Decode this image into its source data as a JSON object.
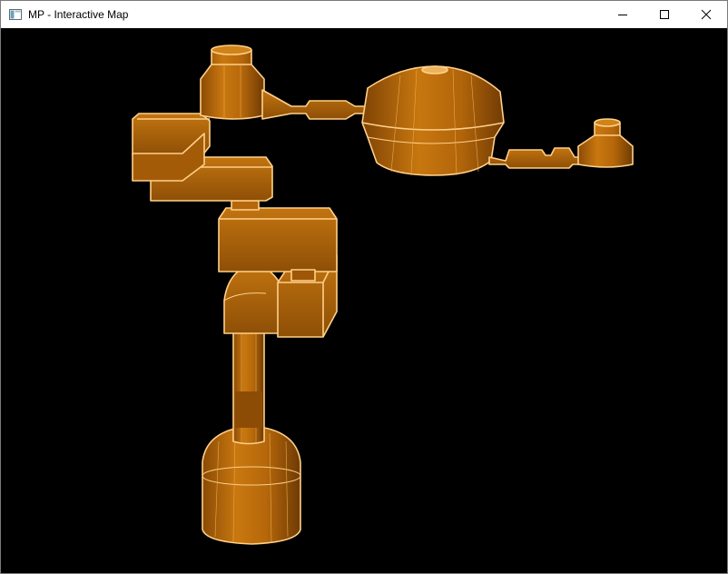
{
  "window": {
    "title": "MP - Interactive Map"
  },
  "icons": {
    "app": "app-window-icon",
    "minimize": "minimize-icon",
    "maximize": "maximize-icon",
    "close": "close-icon"
  },
  "colors": {
    "room_fill": "#b8690a",
    "room_edge": "#ffd089",
    "background": "#000000",
    "titlebar": "#ffffff"
  }
}
